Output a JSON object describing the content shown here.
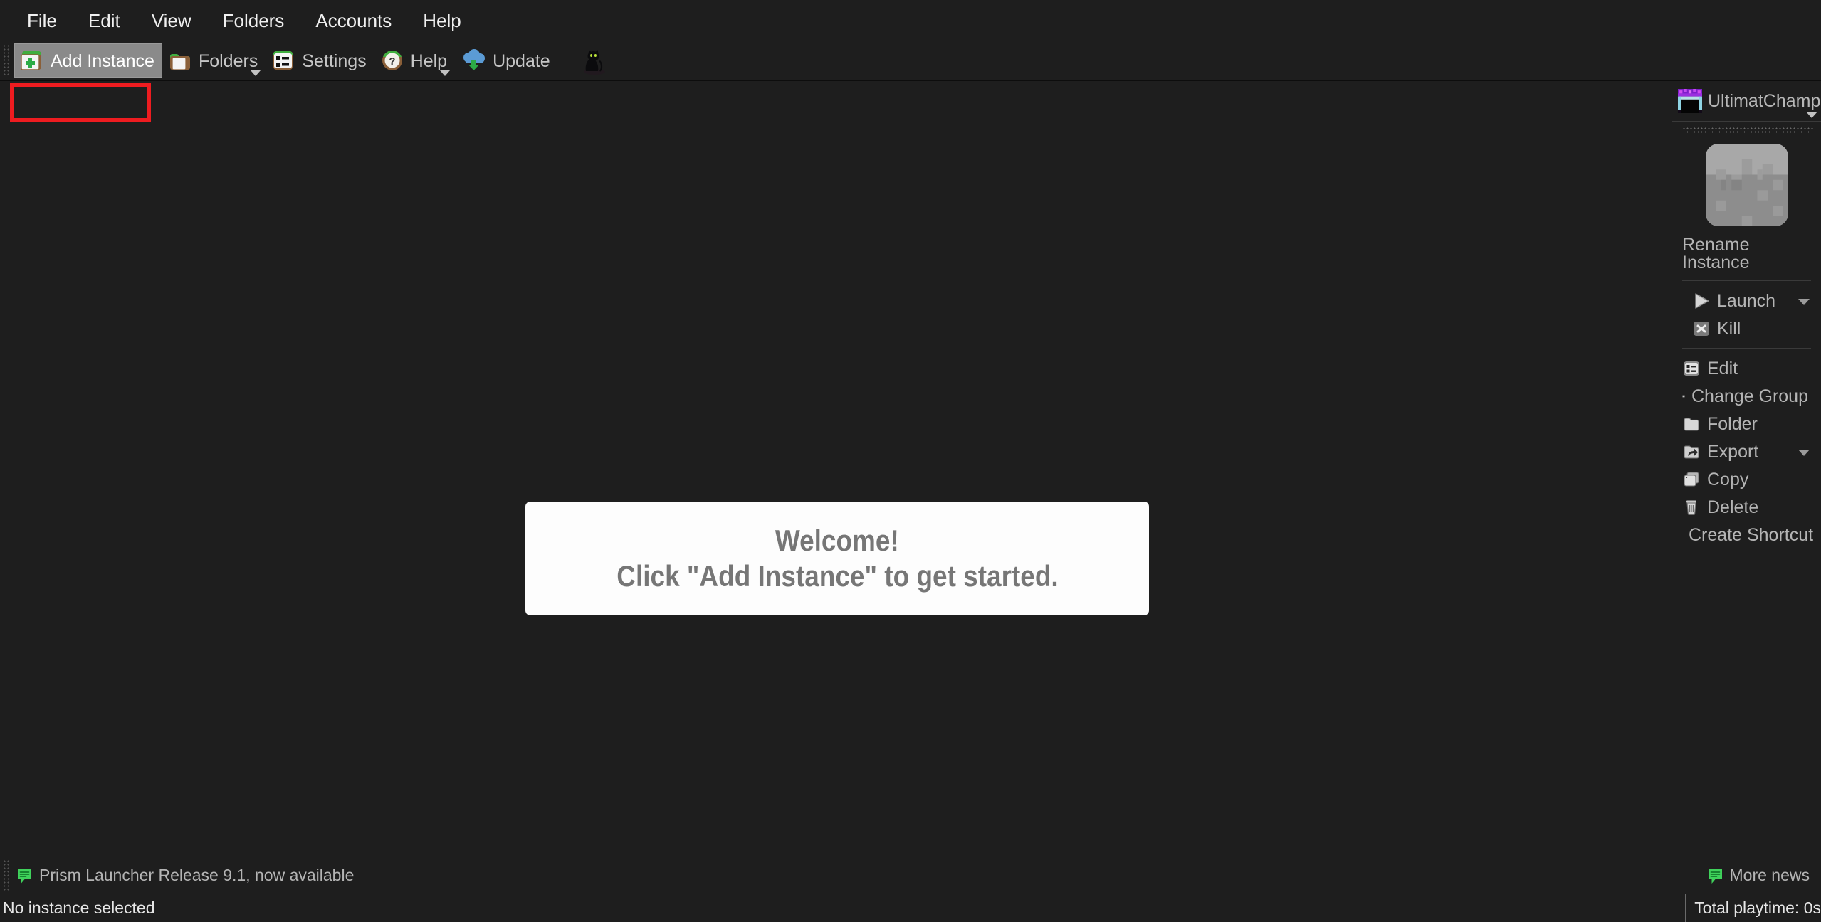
{
  "app": {
    "name": "Prism Launcher",
    "accent_green": "#35c24b",
    "accent_blue": "#5b9bd5",
    "icon_brown": "#8a5f38",
    "highlight_red": "#ee1c20",
    "bg_dark": "#1e1e1e",
    "text_grey": "#b4b4b4"
  },
  "menubar": {
    "items": [
      {
        "label": "File",
        "name": "menu-file"
      },
      {
        "label": "Edit",
        "name": "menu-edit"
      },
      {
        "label": "View",
        "name": "menu-view"
      },
      {
        "label": "Folders",
        "name": "menu-folders"
      },
      {
        "label": "Accounts",
        "name": "menu-accounts"
      },
      {
        "label": "Help",
        "name": "menu-help"
      }
    ]
  },
  "toolbar": {
    "add_instance": {
      "label": "Add Instance",
      "icon": "add-instance-icon",
      "hovered": true,
      "highlighted": true
    },
    "folders": {
      "label": "Folders",
      "icon": "folder-icon",
      "has_dropdown": true
    },
    "settings": {
      "label": "Settings",
      "icon": "settings-icon",
      "has_dropdown": false
    },
    "help": {
      "label": "Help",
      "icon": "help-question-icon",
      "has_dropdown": true
    },
    "update": {
      "label": "Update",
      "icon": "cloud-download-icon",
      "has_dropdown": false
    },
    "cat": {
      "icon": "cat-icon"
    }
  },
  "main": {
    "welcome_title": "Welcome!",
    "welcome_subtitle": "Click \"Add Instance\" to get started."
  },
  "sidebar": {
    "account": {
      "name": "UltimatChamp",
      "avatar": "minecraft-skin-avatar"
    },
    "instance": {
      "icon": "grass-block-icon",
      "rename_label": "Rename Instance"
    },
    "actions_primary": [
      {
        "label": "Launch",
        "icon": "play-icon",
        "has_dropdown": true,
        "name": "sidebar-action-launch"
      },
      {
        "label": "Kill",
        "icon": "kill-x-icon",
        "has_dropdown": false,
        "name": "sidebar-action-kill"
      }
    ],
    "actions_secondary": [
      {
        "label": "Edit",
        "icon": "edit-list-icon",
        "has_dropdown": false,
        "name": "sidebar-action-edit"
      },
      {
        "label": "Change Group",
        "icon": "tag-icon",
        "has_dropdown": false,
        "name": "sidebar-action-change-group"
      },
      {
        "label": "Folder",
        "icon": "folder-icon",
        "has_dropdown": false,
        "name": "sidebar-action-folder"
      },
      {
        "label": "Export",
        "icon": "export-share-icon",
        "has_dropdown": true,
        "name": "sidebar-action-export"
      },
      {
        "label": "Copy",
        "icon": "copy-icon",
        "has_dropdown": false,
        "name": "sidebar-action-copy"
      },
      {
        "label": "Delete",
        "icon": "trash-icon",
        "has_dropdown": false,
        "name": "sidebar-action-delete"
      },
      {
        "label": "Create Shortcut",
        "icon": "shortcut-arrow-icon",
        "has_dropdown": false,
        "name": "sidebar-action-create-shortcut"
      }
    ]
  },
  "newsbar": {
    "headline": "Prism Launcher Release 9.1, now available",
    "more_news": "More news",
    "icon": "news-bubble-icon"
  },
  "statusbar": {
    "selection": "No instance selected",
    "playtime": "Total playtime: 0s"
  }
}
